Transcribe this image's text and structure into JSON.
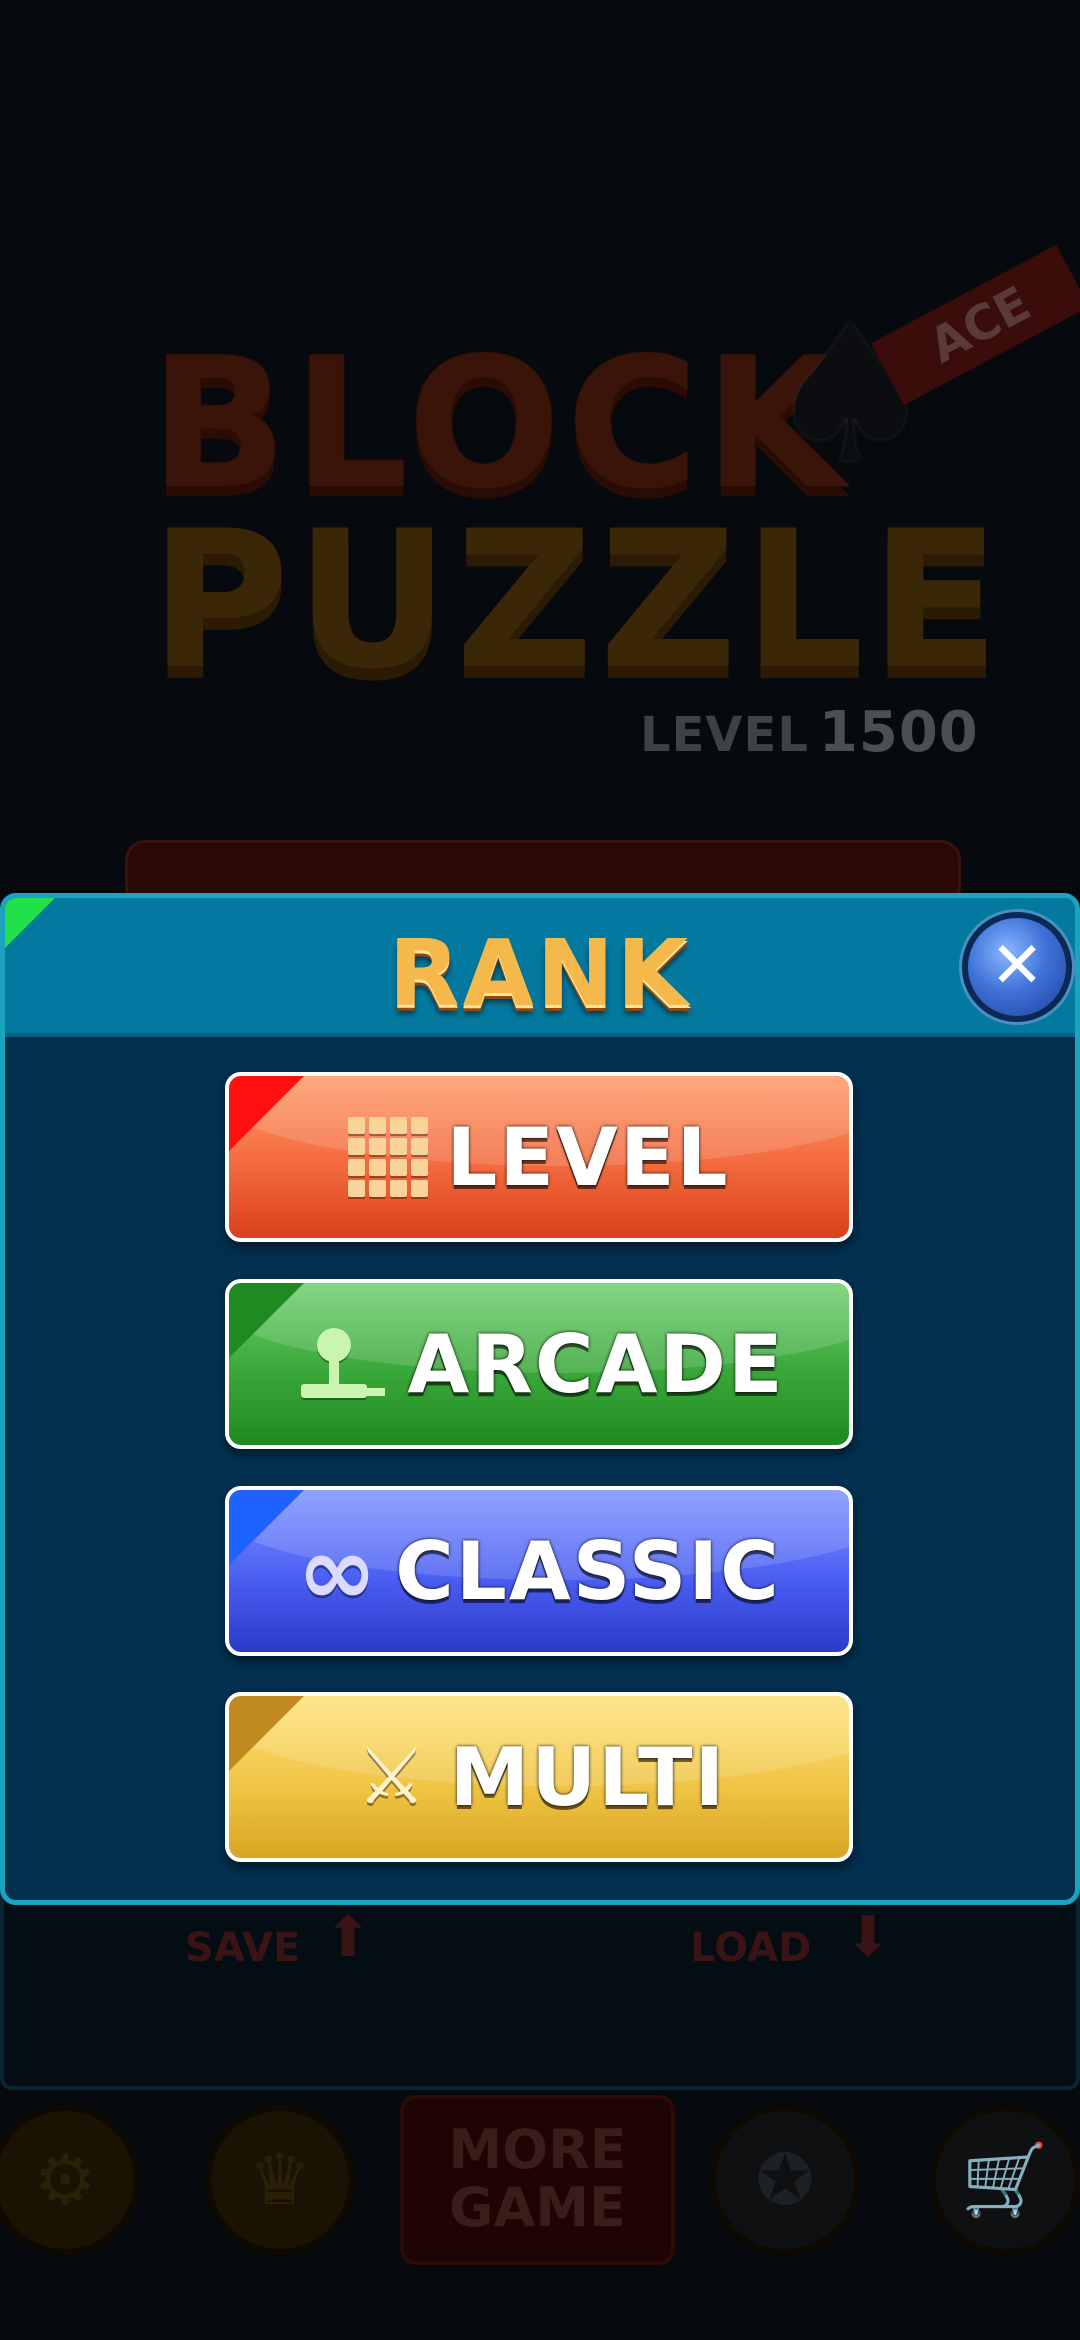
{
  "background": {
    "title_line1": "BLOCK",
    "title_line2": "PUZZLE",
    "badge": "ACE",
    "level_label": "LEVEL",
    "level_value": "1500",
    "save_label": "SAVE",
    "load_label": "LOAD",
    "more_game_label_line1": "MORE",
    "more_game_label_line2": "GAME"
  },
  "modal": {
    "title": "RANK",
    "buttons": [
      {
        "label": "LEVEL",
        "icon": "grid-icon",
        "color": "#f36a3e"
      },
      {
        "label": "ARCADE",
        "icon": "joystick-icon",
        "color": "#3aa73a"
      },
      {
        "label": "CLASSIC",
        "icon": "infinity-icon",
        "color": "#4a5ef2"
      },
      {
        "label": "MULTI",
        "icon": "crossed-swords-icon",
        "color": "#f0c545"
      }
    ]
  }
}
